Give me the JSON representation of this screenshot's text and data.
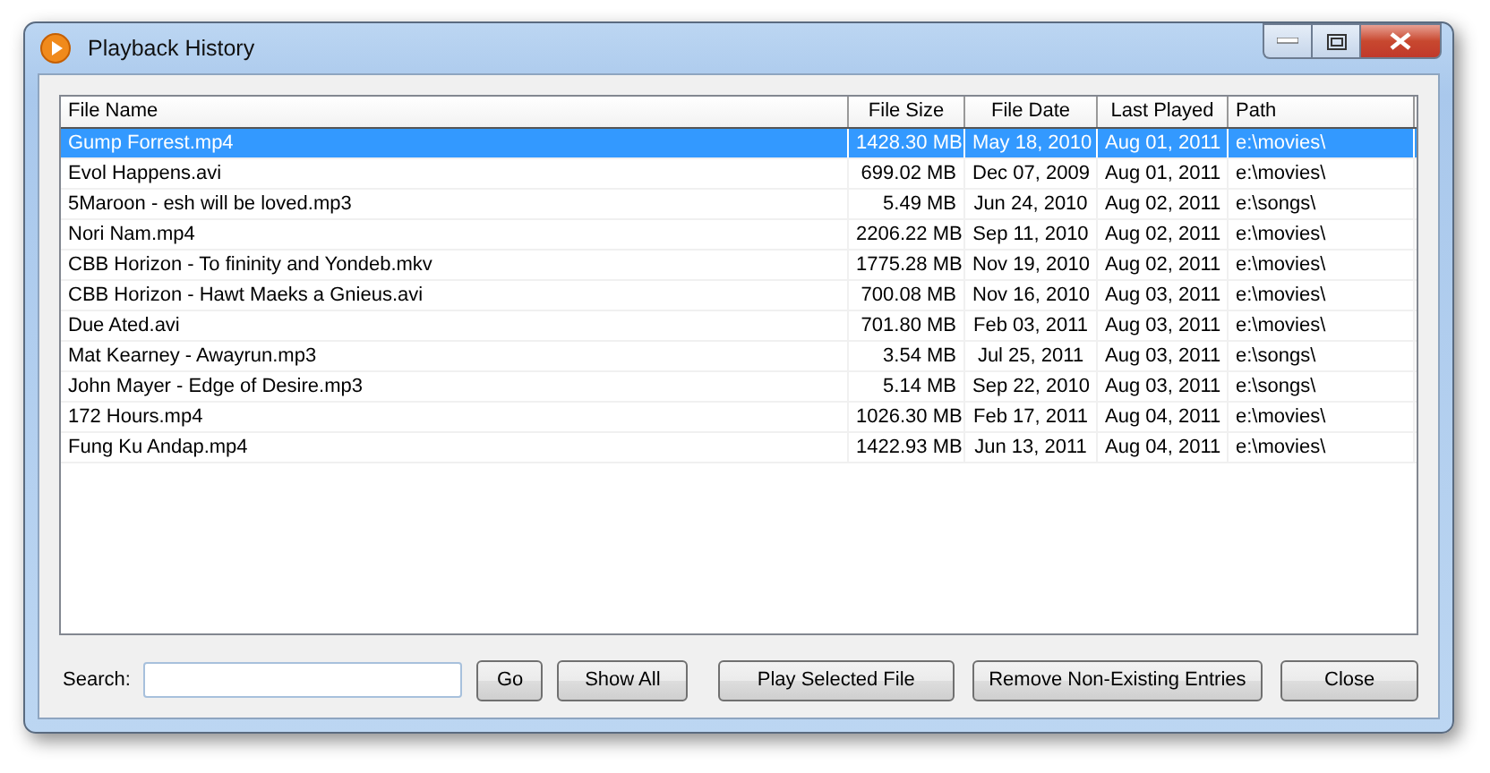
{
  "window": {
    "title": "Playback History"
  },
  "table": {
    "columns": [
      "File Name",
      "File Size",
      "File Date",
      "Last Played",
      "Path"
    ],
    "rows": [
      {
        "cells": [
          "Gump Forrest.mp4",
          "1428.30 MB",
          "May 18, 2010",
          "Aug 01, 2011",
          "e:\\movies\\"
        ],
        "selected": true
      },
      {
        "cells": [
          "Evol Happens.avi",
          "699.02 MB",
          "Dec 07, 2009",
          "Aug 01, 2011",
          "e:\\movies\\"
        ],
        "selected": false
      },
      {
        "cells": [
          "5Maroon - esh will be loved.mp3",
          "5.49 MB",
          "Jun 24, 2010",
          "Aug 02, 2011",
          "e:\\songs\\"
        ],
        "selected": false
      },
      {
        "cells": [
          "Nori Nam.mp4",
          "2206.22 MB",
          "Sep 11, 2010",
          "Aug 02, 2011",
          "e:\\movies\\"
        ],
        "selected": false
      },
      {
        "cells": [
          "CBB Horizon - To fininity and Yondeb.mkv",
          "1775.28 MB",
          "Nov 19, 2010",
          "Aug 02, 2011",
          "e:\\movies\\"
        ],
        "selected": false
      },
      {
        "cells": [
          "CBB Horizon - Hawt Maeks a Gnieus.avi",
          "700.08 MB",
          "Nov 16, 2010",
          "Aug 03, 2011",
          "e:\\movies\\"
        ],
        "selected": false
      },
      {
        "cells": [
          "Due Ated.avi",
          "701.80 MB",
          "Feb 03, 2011",
          "Aug 03, 2011",
          "e:\\movies\\"
        ],
        "selected": false
      },
      {
        "cells": [
          "Mat Kearney - Awayrun.mp3",
          "3.54 MB",
          "Jul 25, 2011",
          "Aug 03, 2011",
          "e:\\songs\\"
        ],
        "selected": false
      },
      {
        "cells": [
          "John Mayer - Edge of Desire.mp3",
          "5.14 MB",
          "Sep 22, 2010",
          "Aug 03, 2011",
          "e:\\songs\\"
        ],
        "selected": false
      },
      {
        "cells": [
          "172 Hours.mp4",
          "1026.30 MB",
          "Feb 17, 2011",
          "Aug 04, 2011",
          "e:\\movies\\"
        ],
        "selected": false
      },
      {
        "cells": [
          "Fung Ku Andap.mp4",
          "1422.93 MB",
          "Jun 13, 2011",
          "Aug 04, 2011",
          "e:\\movies\\"
        ],
        "selected": false
      }
    ]
  },
  "search": {
    "label": "Search:"
  },
  "buttons": [
    "Go",
    "Show All",
    "Play Selected File",
    "Remove Non-Existing Entries",
    "Close"
  ]
}
